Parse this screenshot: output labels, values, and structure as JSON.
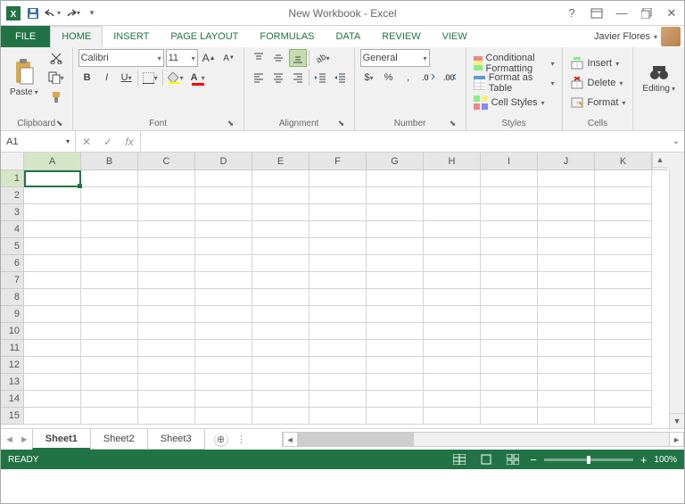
{
  "title": "New Workbook - Excel",
  "quick_access": [
    "excel-icon",
    "save-icon",
    "undo-icon",
    "redo-icon",
    "customize-icon"
  ],
  "window": {
    "help": "?",
    "ribbon_opts": "▢",
    "min": "—",
    "restore": "❐",
    "close": "✕"
  },
  "tabs": [
    "FILE",
    "HOME",
    "INSERT",
    "PAGE LAYOUT",
    "FORMULAS",
    "DATA",
    "REVIEW",
    "VIEW"
  ],
  "active_tab": "HOME",
  "user": {
    "name": "Javier Flores"
  },
  "ribbon": {
    "clipboard": {
      "label": "Clipboard",
      "paste": "Paste"
    },
    "font": {
      "label": "Font",
      "name": "Calibri",
      "size": "11",
      "bold": "B",
      "italic": "I",
      "underline": "U"
    },
    "alignment": {
      "label": "Alignment"
    },
    "number": {
      "label": "Number",
      "format": "General",
      "currency": "$",
      "percent": "%",
      "comma": ","
    },
    "styles": {
      "label": "Styles",
      "conditional": "Conditional Formatting",
      "table": "Format as Table",
      "cell": "Cell Styles"
    },
    "cells": {
      "label": "Cells",
      "insert": "Insert",
      "delete": "Delete",
      "format": "Format"
    },
    "editing": {
      "label": "Editing",
      "find": "Find"
    }
  },
  "namebox": "A1",
  "formula": {
    "fx": "fx",
    "value": ""
  },
  "columns": [
    "A",
    "B",
    "C",
    "D",
    "E",
    "F",
    "G",
    "H",
    "I",
    "J",
    "K"
  ],
  "rows": [
    1,
    2,
    3,
    4,
    5,
    6,
    7,
    8,
    9,
    10,
    11,
    12,
    13,
    14,
    15
  ],
  "active_cell": {
    "col": "A",
    "row": 1
  },
  "sheets": [
    "Sheet1",
    "Sheet2",
    "Sheet3"
  ],
  "active_sheet": "Sheet1",
  "status": {
    "ready": "READY",
    "zoom": "100%"
  }
}
